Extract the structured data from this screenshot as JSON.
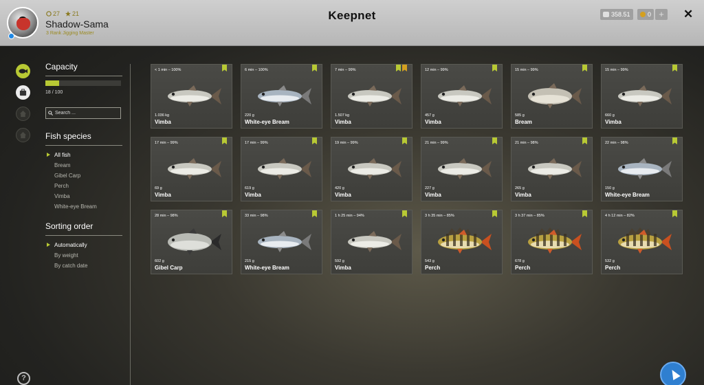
{
  "header": {
    "title": "Keepnet",
    "user": {
      "name": "Shadow-Sama",
      "rank": "3 Rank Jigging Master",
      "level": "27",
      "rating": "21"
    },
    "silver": "358.51",
    "gold": "0",
    "plus_label": "+",
    "close_label": "✕"
  },
  "sidebar": {
    "capacity_title": "Capacity",
    "capacity_text": "18 / 100",
    "capacity_fraction": 0.18,
    "search_placeholder": "Search ...",
    "species_title": "Fish species",
    "species": [
      "All fish",
      "Bream",
      "Gibel Carp",
      "Perch",
      "Vimba",
      "White-eye Bream"
    ],
    "sorting_title": "Sorting order",
    "sorting": [
      "Automatically",
      "By weight",
      "By catch date"
    ]
  },
  "help_label": "?",
  "accent": "#b8c934",
  "fish": [
    {
      "meta": "< 1 min – 100%",
      "weight": "1.036 kg",
      "name": "Vimba",
      "tags": [
        "green"
      ],
      "kind": "silver"
    },
    {
      "meta": "6 min – 100%",
      "weight": "220 g",
      "name": "White-eye Bream",
      "tags": [
        "green"
      ],
      "kind": "whiteeye"
    },
    {
      "meta": "7 min – 99%",
      "weight": "1.507 kg",
      "name": "Vimba",
      "tags": [
        "green",
        "orange"
      ],
      "kind": "silver"
    },
    {
      "meta": "12 min – 99%",
      "weight": "457 g",
      "name": "Vimba",
      "tags": [
        "green"
      ],
      "kind": "silver"
    },
    {
      "meta": "15 min – 99%",
      "weight": "585 g",
      "name": "Bream",
      "tags": [
        "green"
      ],
      "kind": "bream"
    },
    {
      "meta": "15 min – 99%",
      "weight": "660 g",
      "name": "Vimba",
      "tags": [
        "green"
      ],
      "kind": "silver"
    },
    {
      "meta": "17 min – 99%",
      "weight": "69 g",
      "name": "Vimba",
      "tags": [
        "green"
      ],
      "kind": "silver"
    },
    {
      "meta": "17 min – 99%",
      "weight": "619 g",
      "name": "Vimba",
      "tags": [
        "green"
      ],
      "kind": "silver"
    },
    {
      "meta": "19 min – 99%",
      "weight": "420 g",
      "name": "Vimba",
      "tags": [
        "green"
      ],
      "kind": "silver"
    },
    {
      "meta": "21 min – 99%",
      "weight": "227 g",
      "name": "Vimba",
      "tags": [
        "green"
      ],
      "kind": "silver"
    },
    {
      "meta": "21 min – 98%",
      "weight": "265 g",
      "name": "Vimba",
      "tags": [
        "green"
      ],
      "kind": "silver"
    },
    {
      "meta": "22 min – 98%",
      "weight": "150 g",
      "name": "White-eye Bream",
      "tags": [
        "green"
      ],
      "kind": "whiteeye"
    },
    {
      "meta": "28 min – 98%",
      "weight": "602 g",
      "name": "Gibel Carp",
      "tags": [
        "green"
      ],
      "kind": "carp"
    },
    {
      "meta": "33 min – 98%",
      "weight": "215 g",
      "name": "White-eye Bream",
      "tags": [
        "green"
      ],
      "kind": "whiteeye"
    },
    {
      "meta": "1 h 25 min – 94%",
      "weight": "592 g",
      "name": "Vimba",
      "tags": [
        "green"
      ],
      "kind": "silver"
    },
    {
      "meta": "3 h 35 min – 85%",
      "weight": "543 g",
      "name": "Perch",
      "tags": [
        "green"
      ],
      "kind": "perch"
    },
    {
      "meta": "3 h 37 min – 85%",
      "weight": "678 g",
      "name": "Perch",
      "tags": [
        "green"
      ],
      "kind": "perch"
    },
    {
      "meta": "4 h 12 min – 82%",
      "weight": "532 g",
      "name": "Perch",
      "tags": [
        "green"
      ],
      "kind": "perch"
    }
  ]
}
